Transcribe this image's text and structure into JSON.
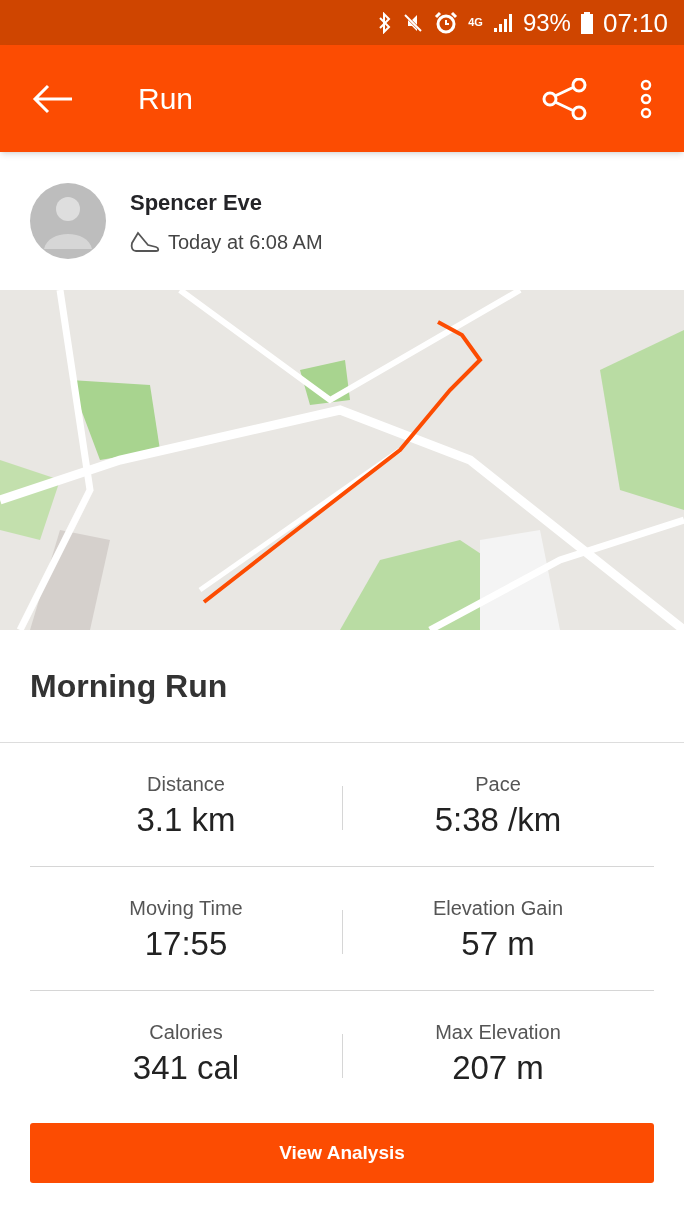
{
  "status_bar": {
    "network": "4G",
    "battery": "93%",
    "time": "07:10"
  },
  "header": {
    "title": "Run"
  },
  "athlete": {
    "name": "Spencer Eve",
    "time": "Today at 6:08 AM"
  },
  "activity": {
    "title": "Morning Run"
  },
  "stats": [
    {
      "label": "Distance",
      "value": "3.1 km"
    },
    {
      "label": "Pace",
      "value": "5:38 /km"
    },
    {
      "label": "Moving Time",
      "value": "17:55"
    },
    {
      "label": "Elevation Gain",
      "value": "57 m"
    },
    {
      "label": "Calories",
      "value": "341 cal"
    },
    {
      "label": "Max Elevation",
      "value": "207 m"
    }
  ],
  "button": {
    "label": "View Analysis"
  }
}
